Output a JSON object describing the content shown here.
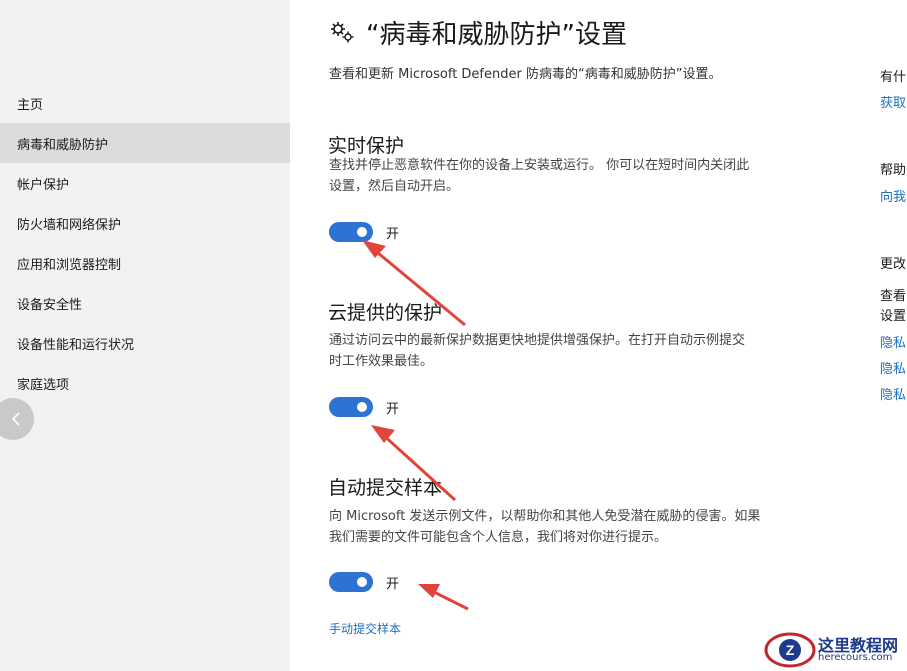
{
  "sidebar": {
    "items": [
      {
        "label": "主页"
      },
      {
        "label": "病毒和威胁防护"
      },
      {
        "label": "帐户保护"
      },
      {
        "label": "防火墙和网络保护"
      },
      {
        "label": "应用和浏览器控制"
      },
      {
        "label": "设备安全性"
      },
      {
        "label": "设备性能和运行状况"
      },
      {
        "label": "家庭选项"
      }
    ],
    "selected_index": 1
  },
  "main": {
    "title": "“病毒和威胁防护”设置",
    "description": "查看和更新 Microsoft Defender 防病毒的“病毒和威胁防护”设置。",
    "sections": [
      {
        "title": "实时保护",
        "desc_line1": "查找并停止恶意软件在你的设备上安装或运行。 你可以在短时间内关闭此",
        "desc_line2": "设置，然后自动开启。",
        "toggle_state": "on",
        "toggle_label": "开"
      },
      {
        "title": "云提供的保护",
        "desc_line1": "通过访问云中的最新保护数据更快地提供增强保护。在打开自动示例提交",
        "desc_line2": "时工作效果最佳。",
        "toggle_state": "on",
        "toggle_label": "开"
      },
      {
        "title": "自动提交样本",
        "desc_line1": "向 Microsoft 发送示例文件，以帮助你和其他人免受潜在威胁的侵害。如果",
        "desc_line2": "我们需要的文件可能包含个人信息，我们将对你进行提示。",
        "toggle_state": "on",
        "toggle_label": "开"
      }
    ],
    "manual_submit_link": "手动提交样本"
  },
  "right_column": {
    "heading1": "有什",
    "link1": "获取",
    "heading2": "帮助",
    "link2": "向我",
    "heading3": "更改",
    "text3a": "查看",
    "text3b": "设置",
    "link3a": "隐私",
    "link3b": "隐私",
    "link3c": "隐私"
  },
  "watermark": {
    "line1": "这里教程网",
    "line2": "herecours.com"
  },
  "colors": {
    "accent": "#2c73d2",
    "link": "#1e6fc2",
    "sidebar_bg": "#f2f2f2",
    "sidebar_selected": "#dcdcdc",
    "annotation_arrow": "#e0443a"
  }
}
